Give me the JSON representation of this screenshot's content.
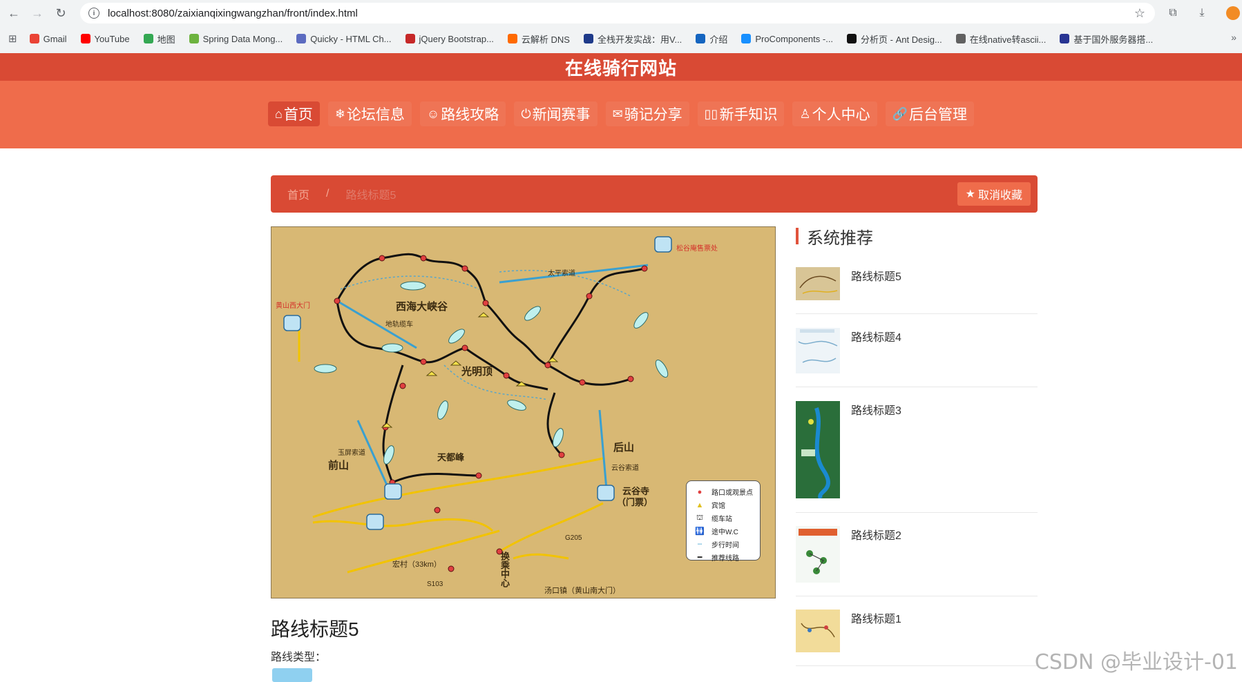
{
  "browser": {
    "url": "localhost:8080/zaixianqixingwangzhan/front/index.html",
    "bookmarks": [
      {
        "label": "Gmail",
        "color": "#ea4335"
      },
      {
        "label": "YouTube",
        "color": "#ff0000"
      },
      {
        "label": "地图",
        "color": "#34a853"
      },
      {
        "label": "Spring Data Mong...",
        "color": "#6db33f"
      },
      {
        "label": "Quicky - HTML Ch...",
        "color": "#5c6bc0"
      },
      {
        "label": "jQuery Bootstrap...",
        "color": "#c62828"
      },
      {
        "label": "云解析 DNS",
        "color": "#ff6a00"
      },
      {
        "label": "全栈开发实战：用V...",
        "color": "#1e3a8a"
      },
      {
        "label": "介绍",
        "color": "#1565c0"
      },
      {
        "label": "ProComponents -...",
        "color": "#1890ff"
      },
      {
        "label": "分析页 - Ant Desig...",
        "color": "#111111"
      },
      {
        "label": "在线native转ascii...",
        "color": "#616161"
      },
      {
        "label": "基于国外服务器搭...",
        "color": "#283593"
      }
    ]
  },
  "site": {
    "title": "在线骑行网站",
    "menu": [
      {
        "icon": "⌂",
        "label": "首页",
        "active": true
      },
      {
        "icon": "❄",
        "label": "论坛信息",
        "active": false
      },
      {
        "icon": "☺",
        "label": "路线攻略",
        "active": false
      },
      {
        "icon": "⏻",
        "label": "新闻赛事",
        "active": false
      },
      {
        "icon": "✉",
        "label": "骑记分享",
        "active": false
      },
      {
        "icon": "▯▯",
        "label": "新手知识",
        "active": false
      },
      {
        "icon": "♙",
        "label": "个人中心",
        "active": false
      },
      {
        "icon": "🔗",
        "label": "后台管理",
        "active": false
      }
    ]
  },
  "breadcrumb": {
    "home": "首页",
    "separator": "/",
    "current": "路线标题5",
    "fav_label": "取消收藏"
  },
  "map": {
    "big_labels": [
      "西海大峡谷",
      "光明顶",
      "前山",
      "后山",
      "天都峰",
      "云谷寺",
      "（门票）",
      "换乘中心"
    ],
    "place_labels": [
      "太平索道",
      "地轨缆车",
      "玉屏索道",
      "云谷索道",
      "汤口镇（黄山南大门）",
      "宏村（33km）",
      "黄山西大门",
      "松谷庵售票处",
      "S103",
      "G205"
    ],
    "legend": [
      "路口或观景点",
      "宾馆",
      "缆车站",
      "途中W.C",
      "步行时间",
      "推荐线路"
    ]
  },
  "route": {
    "title": "路线标题5",
    "type_label": "路线类型："
  },
  "sidebar": {
    "title": "系统推荐",
    "items": [
      {
        "label": "路线标题5"
      },
      {
        "label": "路线标题4"
      },
      {
        "label": "路线标题3"
      },
      {
        "label": "路线标题2"
      },
      {
        "label": "路线标题1"
      }
    ]
  },
  "watermark": "CSDN @毕业设计-01"
}
